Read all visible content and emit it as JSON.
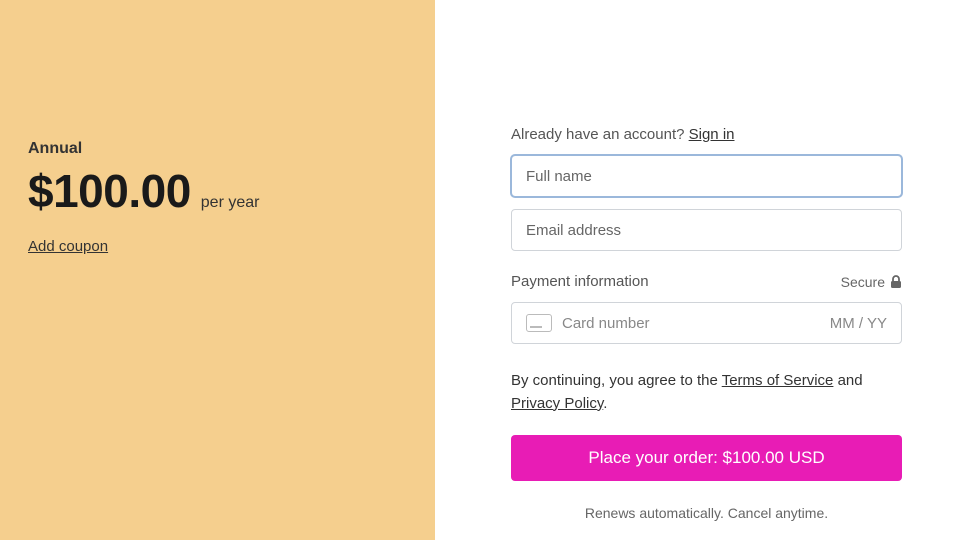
{
  "colors": {
    "left_bg": "#f5cf8e",
    "accent": "#e81cb5"
  },
  "left": {
    "plan_name": "Annual",
    "price": "$100.00",
    "period": "per year",
    "add_coupon": "Add coupon"
  },
  "right": {
    "signin_prompt": "Already have an account? ",
    "signin_link": "Sign in",
    "name_placeholder": "Full name",
    "name_value": "",
    "email_placeholder": "Email address",
    "email_value": "",
    "payment_label": "Payment information",
    "secure_label": "Secure",
    "card_placeholder": "Card number",
    "card_exp_placeholder": "MM / YY",
    "terms_prefix": "By continuing, you agree to the ",
    "terms_link": "Terms of Service",
    "terms_mid": " and ",
    "privacy_link": "Privacy Policy",
    "terms_suffix": ".",
    "order_button": "Place your order: $100.00 USD",
    "renew_text": "Renews automatically. Cancel anytime."
  }
}
